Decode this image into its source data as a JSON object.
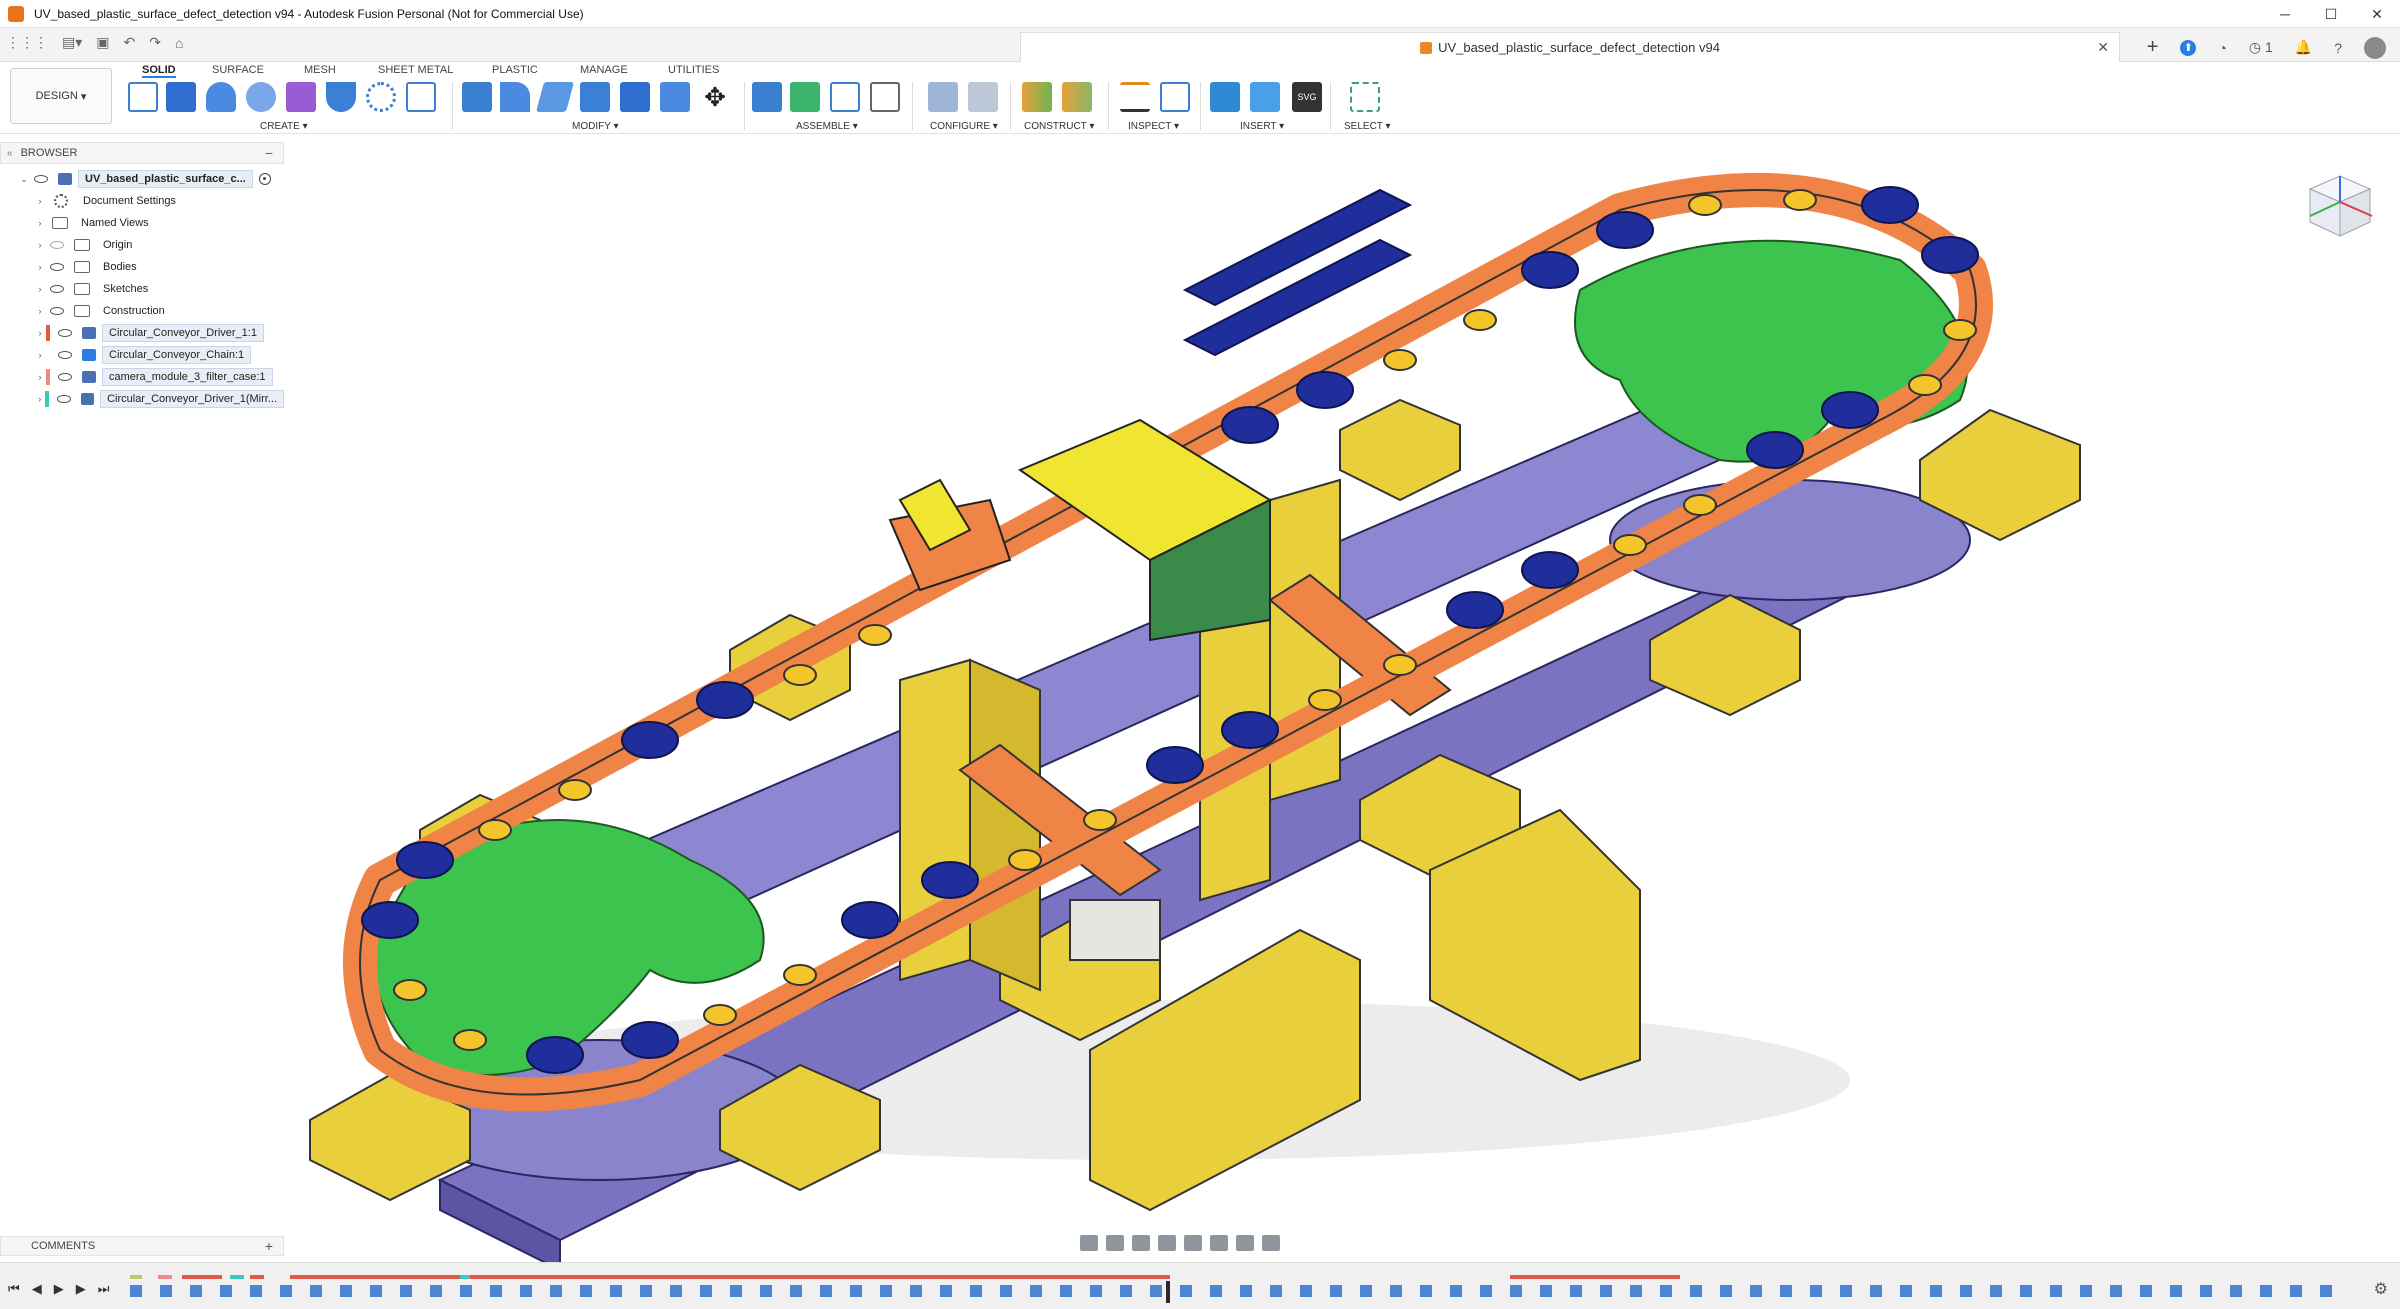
{
  "window": {
    "title": "UV_based_plastic_surface_defect_detection v94 - Autodesk Fusion Personal (Not for Commercial Use)",
    "minimize": "─",
    "maximize": "☐",
    "close": "✕"
  },
  "doc_tab": {
    "title": "UV_based_plastic_surface_defect_detection v94",
    "close": "✕"
  },
  "topbar": {
    "plus": "+",
    "badge": "1"
  },
  "workspace": {
    "label": "DESIGN"
  },
  "ribbon": {
    "tabs": [
      "SOLID",
      "SURFACE",
      "MESH",
      "SHEET METAL",
      "PLASTIC",
      "MANAGE",
      "UTILITIES"
    ],
    "groups": [
      "CREATE",
      "MODIFY",
      "ASSEMBLE",
      "CONFIGURE",
      "CONSTRUCT",
      "INSPECT",
      "INSERT",
      "SELECT"
    ]
  },
  "browser": {
    "header": "BROWSER",
    "root": "UV_based_plastic_surface_c...",
    "items": [
      {
        "label": "Document Settings",
        "icon": "gear-icon"
      },
      {
        "label": "Named Views",
        "icon": "folder-icon"
      },
      {
        "label": "Origin",
        "icon": "folder-icon"
      },
      {
        "label": "Bodies",
        "icon": "folder-icon"
      },
      {
        "label": "Sketches",
        "icon": "folder-icon"
      },
      {
        "label": "Construction",
        "icon": "folder-icon"
      },
      {
        "label": "Circular_Conveyor_Driver_1:1",
        "icon": "component-icon",
        "color": "#e05a4a"
      },
      {
        "label": "Circular_Conveyor_Chain:1",
        "icon": "component-icon",
        "color": ""
      },
      {
        "label": "camera_module_3_filter_case:1",
        "icon": "component-icon",
        "color": "#f08a8a"
      },
      {
        "label": "Circular_Conveyor_Driver_1(Mirr...",
        "icon": "component-icon",
        "color": "#3cc9c0"
      }
    ]
  },
  "comments": {
    "label": "COMMENTS",
    "plus": "+"
  },
  "timeline": {
    "first": "⏮",
    "prev": "◀",
    "play": "▶",
    "next": "▶",
    "last": "⏭"
  },
  "colors": {
    "chain_orange": "#ef8446",
    "plate_green": "#3cc44e",
    "support_yellow": "#e9cf3c",
    "rail_purple": "#7b73c2",
    "roller_navy": "#1f2e9a",
    "cap_yellow": "#f4c52a"
  }
}
